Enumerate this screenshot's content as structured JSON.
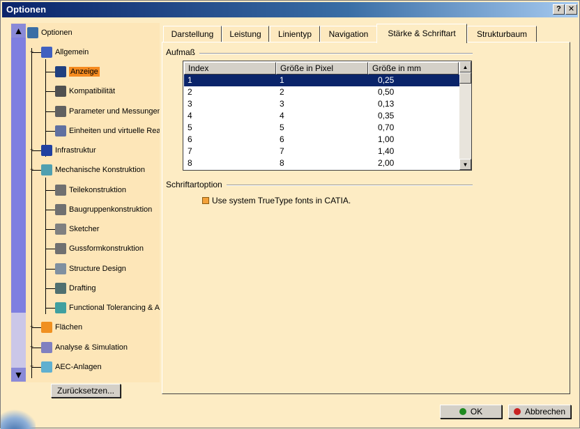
{
  "window": {
    "title": "Optionen",
    "help_label": "?",
    "close_label": "✕"
  },
  "tree": {
    "items": [
      {
        "label": "Optionen",
        "icon": "options-root-icon",
        "color": "#3a6ea5"
      },
      {
        "label": "Allgemein",
        "icon": "general-icon",
        "color": "#4060c0"
      },
      {
        "label": "Anzeige",
        "icon": "display-icon",
        "color": "#204080",
        "selected": true
      },
      {
        "label": "Kompatibilität",
        "icon": "compatibility-icon",
        "color": "#505050"
      },
      {
        "label": "Parameter und Messungen",
        "icon": "parameters-icon",
        "color": "#606060"
      },
      {
        "label": "Einheiten und virtuelle Real",
        "icon": "units-icon",
        "color": "#6070a0"
      },
      {
        "label": "Infrastruktur",
        "icon": "infrastructure-icon",
        "color": "#2040a0"
      },
      {
        "label": "Mechanische Konstruktion",
        "icon": "mechanical-design-icon",
        "color": "#50a0b0"
      },
      {
        "label": "Teilekonstruktion",
        "icon": "part-design-icon",
        "color": "#707070"
      },
      {
        "label": "Baugruppenkonstruktion",
        "icon": "assembly-design-icon",
        "color": "#707070"
      },
      {
        "label": "Sketcher",
        "icon": "sketcher-icon",
        "color": "#808080"
      },
      {
        "label": "Gussformkonstruktion",
        "icon": "mold-design-icon",
        "color": "#707070"
      },
      {
        "label": "Structure Design",
        "icon": "structure-design-icon",
        "color": "#8090a0"
      },
      {
        "label": "Drafting",
        "icon": "drafting-icon",
        "color": "#507070"
      },
      {
        "label": "Functional Tolerancing & A",
        "icon": "tolerancing-icon",
        "color": "#40a0a0"
      },
      {
        "label": "Flächen",
        "icon": "surfaces-icon",
        "color": "#f09020"
      },
      {
        "label": "Analyse & Simulation",
        "icon": "analysis-icon",
        "color": "#8080c0"
      },
      {
        "label": "AEC-Anlagen",
        "icon": "aec-plants-icon",
        "color": "#60b0d0"
      }
    ]
  },
  "buttons": {
    "reset": "Zurücksetzen...",
    "ok": "OK",
    "cancel": "Abbrechen"
  },
  "tabs": [
    {
      "label": "Darstellung"
    },
    {
      "label": "Leistung"
    },
    {
      "label": "Linientyp"
    },
    {
      "label": "Navigation"
    },
    {
      "label": "Stärke & Schriftart",
      "active": true
    },
    {
      "label": "Strukturbaum"
    }
  ],
  "thickness_group": {
    "title": "Aufmaß",
    "columns": [
      "Index",
      "Größe in Pixel",
      "Größe in mm"
    ],
    "rows": [
      [
        "1",
        "1",
        "0,25"
      ],
      [
        "2",
        "2",
        "0,50"
      ],
      [
        "3",
        "3",
        "0,13"
      ],
      [
        "4",
        "4",
        "0,35"
      ],
      [
        "5",
        "5",
        "0,70"
      ],
      [
        "6",
        "6",
        "1,00"
      ],
      [
        "7",
        "7",
        "1,40"
      ],
      [
        "8",
        "8",
        "2,00"
      ]
    ],
    "selected_row": 0
  },
  "font_group": {
    "title": "Schriftartoption",
    "checkbox_label": "Use system TrueType fonts in CATIA."
  },
  "colors": {
    "selection": "#0a246a",
    "tree_selected": "#f58a1f",
    "background": "#fdecc4"
  }
}
